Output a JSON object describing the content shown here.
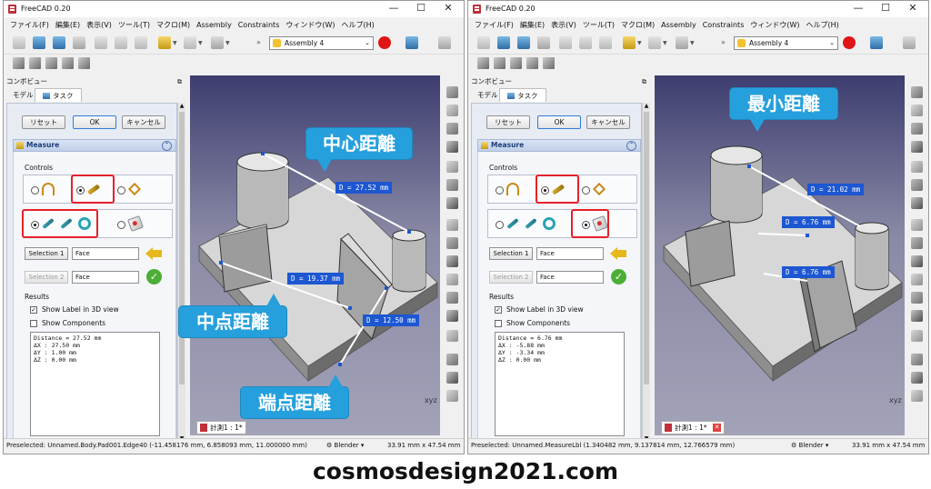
{
  "windows": [
    {
      "id": "left",
      "title": "FreeCAD 0.20",
      "menu": [
        "ファイル(F)",
        "編集(E)",
        "表示(V)",
        "ツール(T)",
        "マクロ(M)",
        "Assembly",
        "Constraints",
        "ウィンドウ(W)",
        "ヘルプ(H)"
      ],
      "workbench": "Assembly 4",
      "combo_title": "コンボビュー",
      "tabs": [
        "モデル",
        "タスク"
      ],
      "buttons": {
        "reset": "リセット",
        "ok": "OK",
        "cancel": "キャンセル"
      },
      "panel_title": "Measure",
      "controls_label": "Controls",
      "selection1_label": "Selection 1",
      "selection1_value": "Face",
      "selection2_label": "Selection 2",
      "selection2_value": "Face",
      "results_label": "Results",
      "show_label": "Show Label in 3D view",
      "show_components": "Show Components",
      "results_lines": [
        "Distance = 27.52 mm",
        "ΔX : 27.50 mm",
        "ΔY : 1.00 mm",
        "ΔZ : 0.00 mm"
      ],
      "doc_tab": "計測1 : 1*",
      "status": "Preselected: Unnamed.Body.Pad001.Edge40 (-11.458176 mm, 6.858093 mm, 11.000000 mm)",
      "nav_style": "Blender",
      "dims": "33.91 mm x 47.54 mm",
      "labels": [
        "D = 27.52 mm",
        "D = 19.37 mm",
        "D = 12.50 mm"
      ],
      "callouts": [
        "中心距離",
        "中点距離",
        "端点距離"
      ]
    },
    {
      "id": "right",
      "title": "FreeCAD 0.20",
      "menu": [
        "ファイル(F)",
        "編集(E)",
        "表示(V)",
        "ツール(T)",
        "マクロ(M)",
        "Assembly",
        "Constraints",
        "ウィンドウ(W)",
        "ヘルプ(H)"
      ],
      "workbench": "Assembly 4",
      "combo_title": "コンボビュー",
      "tabs": [
        "モデル",
        "タスク"
      ],
      "buttons": {
        "reset": "リセット",
        "ok": "OK",
        "cancel": "キャンセル"
      },
      "panel_title": "Measure",
      "controls_label": "Controls",
      "selection1_label": "Selection 1",
      "selection1_value": "Face",
      "selection2_label": "Selection 2",
      "selection2_value": "Face",
      "results_label": "Results",
      "show_label": "Show Label in 3D view",
      "show_components": "Show Components",
      "results_lines": [
        "Distance = 6.76 mm",
        "ΔX : -5.88 mm",
        "ΔY : -3.34 mm",
        "ΔZ : 0.00 mm"
      ],
      "doc_tab": "計測1 : 1*",
      "status": "Preselected: Unnamed.MeasureLbl (1.340482 mm, 9.137814 mm, 12.766579 mm)",
      "nav_style": "Blender",
      "dims": "33.91 mm x 47.54 mm",
      "labels": [
        "D = 21.02 mm",
        "D = 6.76 mm",
        "D = 6.76 mm"
      ],
      "callouts": [
        "最小距離"
      ]
    }
  ],
  "controls_state": {
    "left": {
      "row1_selected": "point-to-point",
      "row2_selected": "edges"
    },
    "right": {
      "row1_selected": "point-to-point",
      "row2_selected": "label"
    }
  },
  "colors": {
    "callout": "#26a0dc",
    "label_bg": "#1d57d2",
    "highlight": "#e5202a",
    "record": "#e01515"
  },
  "watermark": "cosmosdesign2021.com"
}
